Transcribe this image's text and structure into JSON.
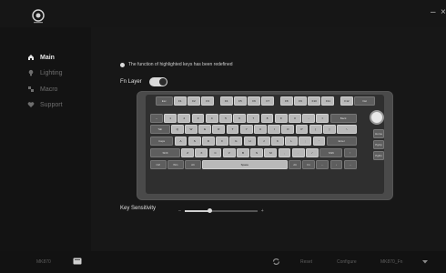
{
  "window": {
    "minimize_glyph": "–",
    "close_glyph": "×"
  },
  "sidebar": {
    "items": [
      {
        "label": "Main",
        "icon": "home-icon",
        "active": true
      },
      {
        "label": "Lighting",
        "icon": "bulb-icon",
        "active": false
      },
      {
        "label": "Macro",
        "icon": "macro-icon",
        "active": false
      },
      {
        "label": "Support",
        "icon": "heart-icon",
        "active": false
      }
    ]
  },
  "main": {
    "notice": "The function of highlighted keys has been redefined",
    "fn_layer_label": "Fn Layer",
    "fn_layer_on": true,
    "key_sensitivity_label": "Key Sensitivity",
    "sensitivity_min_glyph": "–",
    "sensitivity_max_glyph": "+",
    "sensitivity_level": 0.35
  },
  "keyboard": {
    "row0": [
      "Esc",
      "F1",
      "F2",
      "F3",
      "F4",
      "F5",
      "F6",
      "F7",
      "F8",
      "F9",
      "F10",
      "F11",
      "F12",
      "Del"
    ],
    "row1": [
      "~",
      "1",
      "2",
      "3",
      "4",
      "5",
      "6",
      "7",
      "8",
      "9",
      "0",
      "-",
      "=",
      "Back"
    ],
    "row2": [
      "Tab",
      "Q",
      "W",
      "E",
      "R",
      "T",
      "Y",
      "U",
      "I",
      "O",
      "P",
      "[",
      "]",
      "\\"
    ],
    "row3": [
      "Caps",
      "A",
      "S",
      "D",
      "F",
      "G",
      "H",
      "J",
      "K",
      "L",
      ";",
      "'",
      "Enter"
    ],
    "row4": [
      "Shift",
      "Z",
      "X",
      "C",
      "V",
      "B",
      "N",
      "M",
      ",",
      ".",
      "/",
      "Shift",
      "↑"
    ],
    "row5": [
      "Ctrl",
      "Win",
      "Alt",
      "Space",
      "Alt",
      "Fn",
      "←",
      "↓",
      "→"
    ],
    "side": [
      "Home",
      "PgUp",
      "PgDn"
    ]
  },
  "bottom": {
    "model": "MK870",
    "reset_label": "Reset",
    "configure_label": "Configure",
    "profile_label": "MK870_Fn"
  }
}
